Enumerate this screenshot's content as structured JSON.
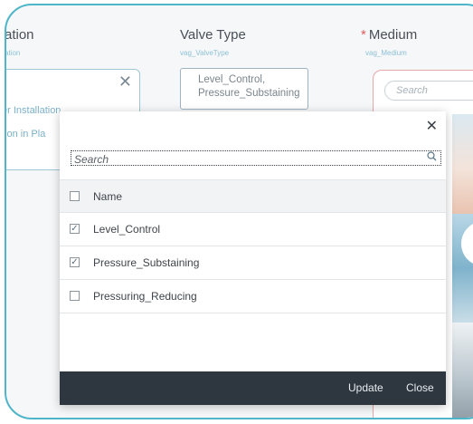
{
  "background": {
    "col1": {
      "title": "ation",
      "sub": "ation",
      "options": [
        "er Installation",
        "tion in Pla"
      ]
    },
    "col2": {
      "title": "Valve Type",
      "sub": "vag_ValveType",
      "value_line1": "Level_Control,",
      "value_line2": "Pressure_Substaining"
    },
    "col3": {
      "required_mark": "*",
      "title": "Medium",
      "sub": "vag_Medium",
      "search_placeholder": "Search"
    }
  },
  "modal": {
    "close_glyph": "✕",
    "search_placeholder": "Search",
    "header_label": "Name",
    "items": [
      {
        "label": "Level_Control",
        "checked": true
      },
      {
        "label": "Pressure_Substaining",
        "checked": true
      },
      {
        "label": "Pressuring_Reducing",
        "checked": false
      }
    ],
    "update_label": "Update",
    "close_label": "Close"
  },
  "colors": {
    "frame": "#4fb5c8",
    "footer": "#2e3740",
    "required": "#e05c5c"
  }
}
